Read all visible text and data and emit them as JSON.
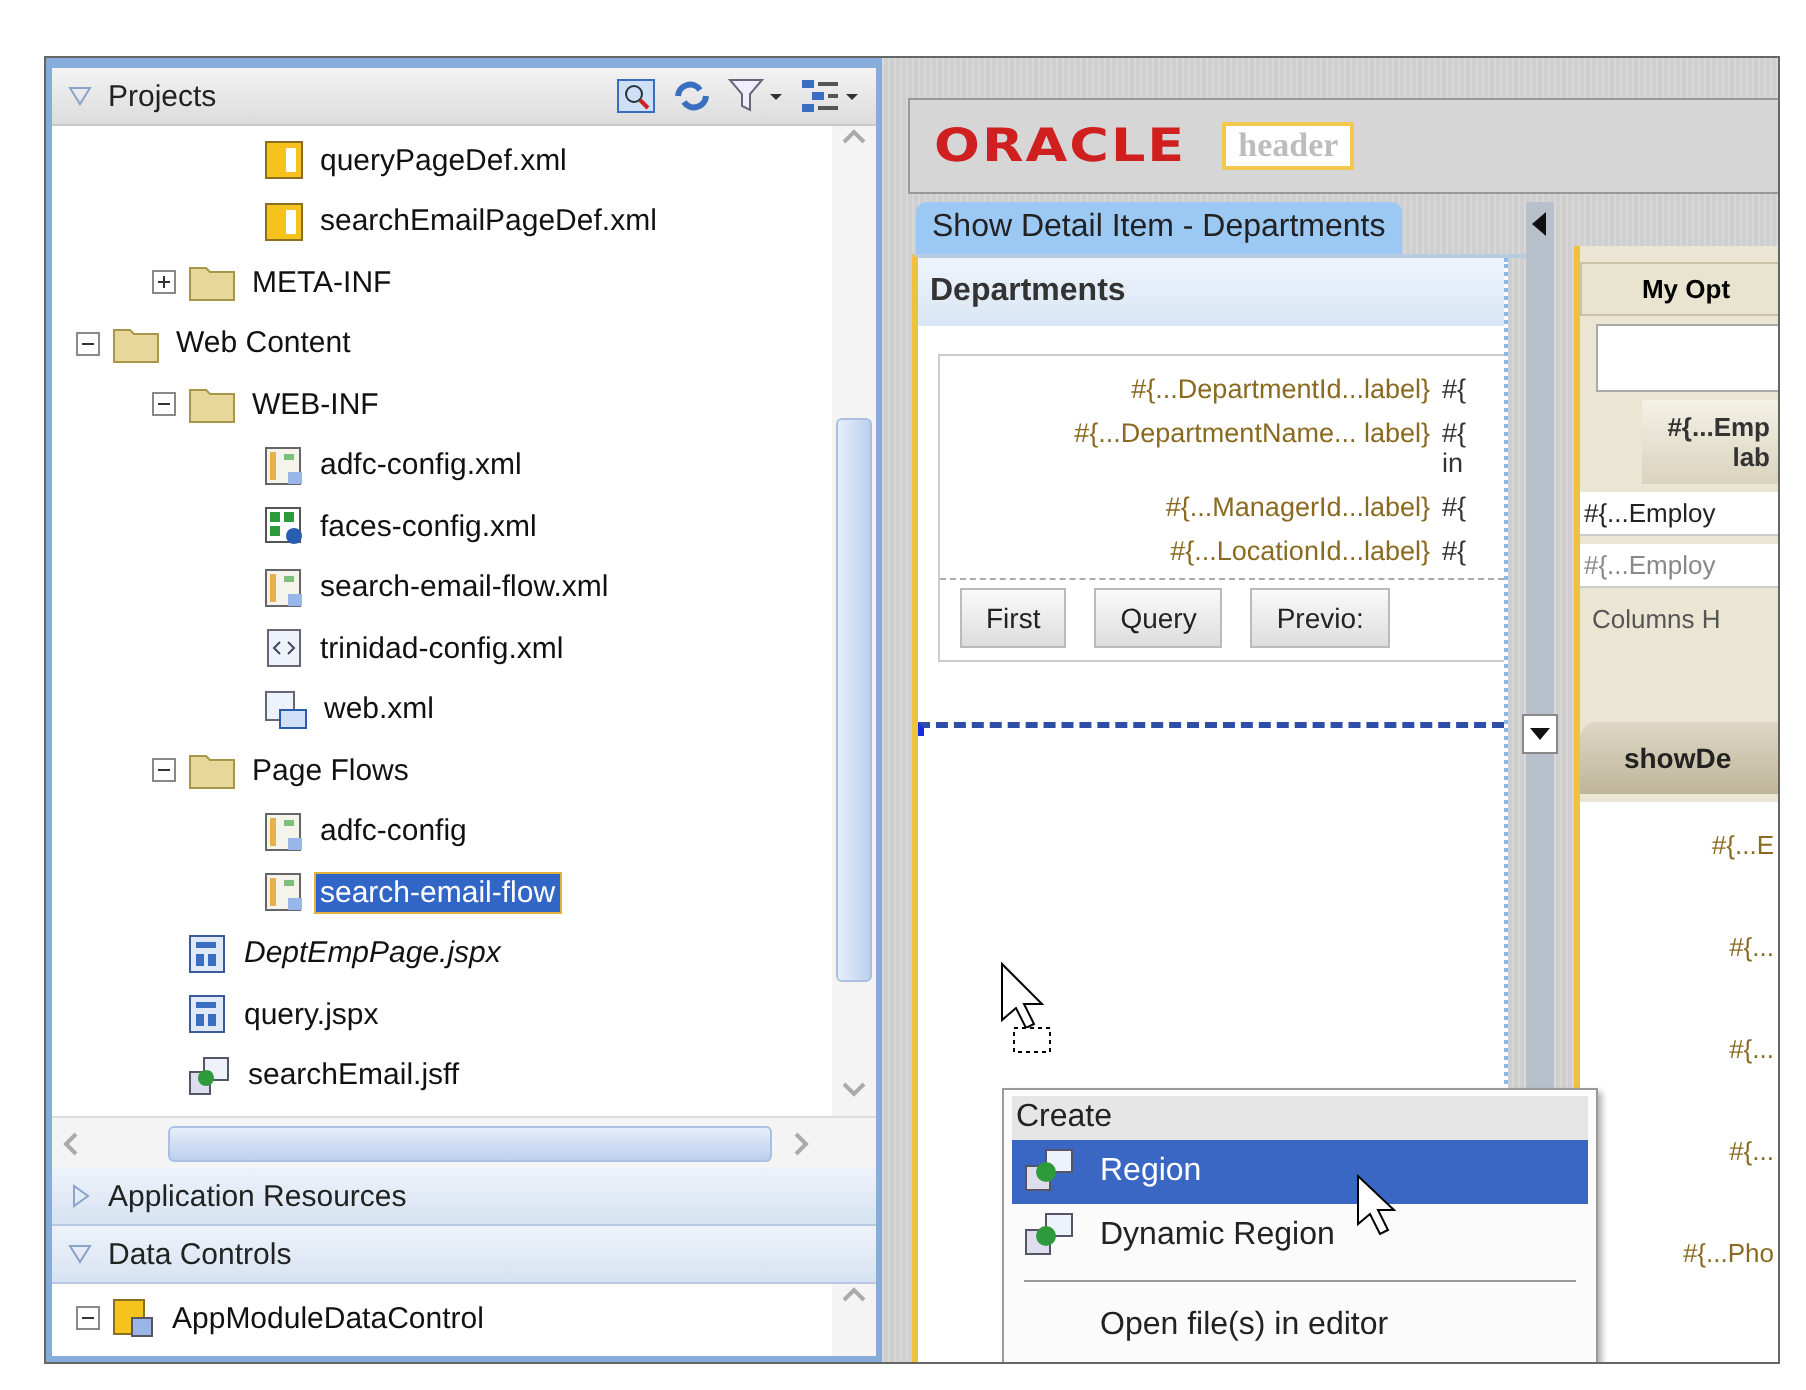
{
  "projects_panel": {
    "title": "Projects",
    "tree": [
      {
        "children": [
          {
            "children": [
              {
                "label": "queryPageDef.xml",
                "kind": "pagedef",
                "selected": false,
                "unsaved": false
              },
              {
                "label": "searchEmailPageDef.xml",
                "kind": "pagedef",
                "selected": false,
                "unsaved": false
              }
            ]
          },
          {
            "label": "META-INF",
            "kind": "folder",
            "expanded": false,
            "selected": false,
            "unsaved": false
          }
        ]
      },
      {
        "label": "Web Content",
        "kind": "folder",
        "expanded": true,
        "selected": false,
        "unsaved": false,
        "children": [
          {
            "label": "WEB-INF",
            "kind": "folder",
            "expanded": true,
            "selected": false,
            "unsaved": false,
            "children": [
              {
                "label": "adfc-config.xml",
                "kind": "flow",
                "selected": false,
                "unsaved": false
              },
              {
                "label": "faces-config.xml",
                "kind": "faces",
                "selected": false,
                "unsaved": false
              },
              {
                "label": "search-email-flow.xml",
                "kind": "flow",
                "selected": false,
                "unsaved": false
              },
              {
                "label": "trinidad-config.xml",
                "kind": "xml",
                "selected": false,
                "unsaved": false
              },
              {
                "label": "web.xml",
                "kind": "webxml",
                "selected": false,
                "unsaved": false
              }
            ]
          },
          {
            "label": "Page Flows",
            "kind": "folder",
            "expanded": true,
            "selected": false,
            "unsaved": false,
            "children": [
              {
                "label": "adfc-config",
                "kind": "flow",
                "selected": false,
                "unsaved": false
              },
              {
                "label": "search-email-flow",
                "kind": "flow",
                "selected": true,
                "unsaved": false
              }
            ]
          },
          {
            "label": "DeptEmpPage.jspx",
            "kind": "page",
            "selected": false,
            "unsaved": true
          },
          {
            "label": "query.jspx",
            "kind": "page",
            "selected": false,
            "unsaved": false
          },
          {
            "label": "searchEmail.jsff",
            "kind": "fragment",
            "selected": false,
            "unsaved": false
          }
        ]
      }
    ]
  },
  "accordion": [
    {
      "title": "Application Resources",
      "expanded": false
    },
    {
      "title": "Data Controls",
      "expanded": true
    }
  ],
  "data_controls_tree": [
    {
      "label": "AppModuleDataControl",
      "kind": "datacontrol",
      "expanded": true
    }
  ],
  "designer": {
    "logo": "ORACLE",
    "header_label": "header",
    "tab_title": "Show Detail Item - Departments",
    "panel_title": "Departments",
    "form_rows": [
      {
        "label": "#{...DepartmentId...label}",
        "value": "#{"
      },
      {
        "label": "#{...DepartmentName... label}",
        "value": "#{ in"
      },
      {
        "label": "#{...ManagerId...label}",
        "value": "#{"
      },
      {
        "label": "#{...LocationId...label}",
        "value": "#{"
      }
    ],
    "buttons": [
      "First",
      "Query",
      "Previo:"
    ],
    "side_panel": {
      "button": "My Opt",
      "table_header": "#{...Emp lab",
      "rows": [
        "#{...Employ",
        "#{...Employ"
      ],
      "footer": "Columns H",
      "tab": "showDe",
      "labels": [
        "#{...E",
        "#{...",
        "#{...",
        "#{...",
        "#{...Pho"
      ]
    }
  },
  "context_menu": {
    "header": "Create",
    "items": [
      {
        "kind": "command",
        "label": "Region",
        "selected": true
      },
      {
        "kind": "command",
        "label": "Dynamic Region",
        "selected": false
      },
      {
        "kind": "separator"
      },
      {
        "kind": "plain",
        "label": "Open file(s) in editor",
        "selected": false
      }
    ]
  }
}
